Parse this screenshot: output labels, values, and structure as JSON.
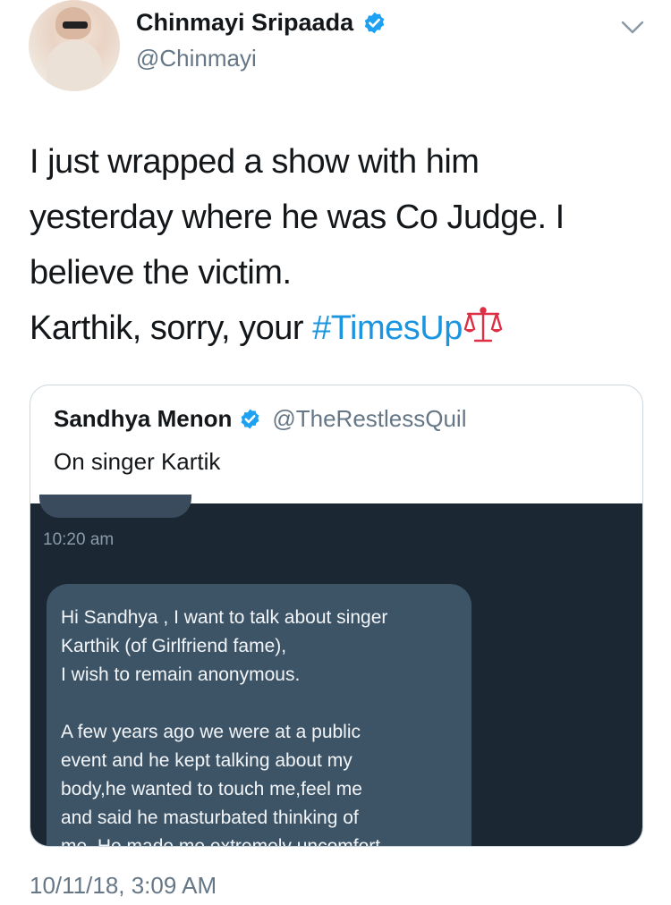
{
  "author": {
    "name": "Chinmayi Sripaada",
    "handle": "@Chinmayi",
    "verified": true
  },
  "tweet": {
    "lines": [
      "I just wrapped a show with him",
      "yesterday where he was Co Judge. I",
      "believe the victim."
    ],
    "last_line_prefix": "Karthik, sorry, your ",
    "hashtag": "#TimesUp",
    "emoji_icon": "balance-scale-icon",
    "timestamp": "10/11/18, 3:09 AM"
  },
  "quoted_tweet": {
    "name": "Sandhya Menon",
    "handle": "@TheRestlessQuil",
    "verified": true,
    "text": "On singer Kartik",
    "screenshot": {
      "time": "10:20 am",
      "message_lines": [
        "Hi Sandhya , I want to talk about singer",
        "Karthik (of Girlfriend fame),",
        "I wish to remain anonymous.",
        "",
        "A few years ago we were at a public",
        "event and he kept talking about my",
        "body,he  wanted to touch me,feel me",
        "and said he masturbated thinking of",
        "me. He made me extremely uncomfort-"
      ]
    }
  },
  "colors": {
    "link": "#1b95e0",
    "verified": "#1da1f2",
    "secondary_text": "#657786",
    "dm_background": "#1b2733",
    "dm_bubble": "#3d5467"
  }
}
